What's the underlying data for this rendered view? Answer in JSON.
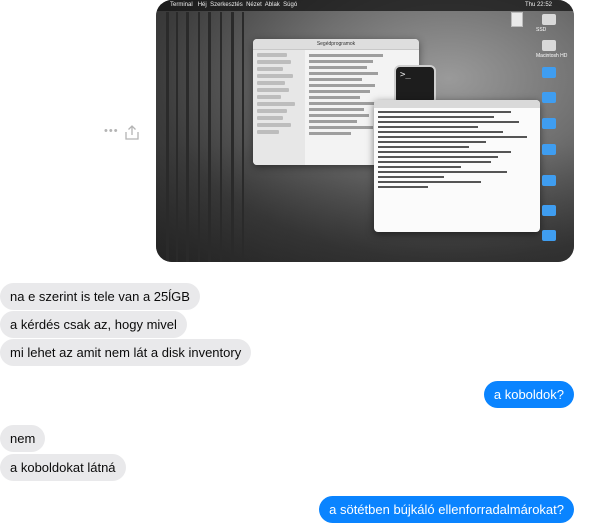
{
  "conversation": {
    "shared_image": {
      "menubar": {
        "app": "Terminal",
        "items": [
          "Héj",
          "Szerkesztés",
          "Nézet",
          "Ablak",
          "Súgó"
        ],
        "clock": "Thu 22:52"
      },
      "finder_title": "Segédprogramok",
      "desktop_labels": [
        "SSD",
        "Macintosh HD"
      ]
    },
    "messages": [
      {
        "side": "received",
        "text": "na e szerint is tele van a 25ĺGB"
      },
      {
        "side": "received",
        "text": "a kérdés csak az, hogy mivel"
      },
      {
        "side": "received",
        "text": "mi lehet az amit nem lát a disk inventory"
      },
      {
        "side": "sent",
        "text": "a koboldok?"
      },
      {
        "side": "received",
        "text": "nem"
      },
      {
        "side": "received",
        "text": "a koboldokat látná"
      },
      {
        "side": "sent",
        "text": "a sötétben bújkáló ellenforradalmárokat?"
      }
    ]
  },
  "colors": {
    "sent_bubble": "#0a84ff",
    "received_bubble": "#e9e9eb"
  }
}
